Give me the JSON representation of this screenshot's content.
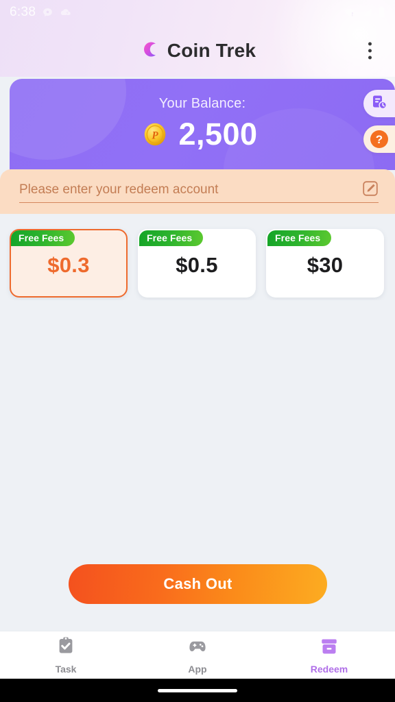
{
  "status_bar": {
    "time": "6:38",
    "left_icons": [
      "chat-bubble-icon",
      "cloud-icon"
    ],
    "right_icons": [
      "wifi-warning-icon",
      "cellular-signal-icon",
      "battery-icon"
    ]
  },
  "header": {
    "logo_icon": "coin-trek-logo-icon",
    "title": "Coin Trek",
    "menu_icon": "overflow-menu-icon"
  },
  "balance_card": {
    "label": "Your Balance:",
    "amount": "2,500",
    "coin_icon": "gold-coin-p-icon",
    "gradient_from": "#8e6ef4",
    "gradient_to": "#8d6bf3"
  },
  "side_buttons": {
    "records": {
      "icon": "records-history-icon",
      "name": "records-button"
    },
    "help": {
      "icon": "question-mark-icon",
      "label": "?",
      "name": "help-button"
    }
  },
  "account_input": {
    "placeholder": "Please enter your redeem account",
    "value": "",
    "edit_icon": "edit-pencil-icon",
    "panel_color": "#fbdcc3"
  },
  "amount_options": [
    {
      "badge": "Free Fees",
      "value": "$0.3",
      "selected": true
    },
    {
      "badge": "Free Fees",
      "value": "$0.5",
      "selected": false
    },
    {
      "badge": "Free Fees",
      "value": "$30",
      "selected": false
    }
  ],
  "cash_out": {
    "label": "Cash Out",
    "gradient_from": "#f4511e",
    "gradient_to": "#fcac21"
  },
  "bottom_nav": {
    "items": [
      {
        "label": "Task",
        "icon": "clipboard-check-icon",
        "active": false
      },
      {
        "label": "App",
        "icon": "gamepad-icon",
        "active": false
      },
      {
        "label": "Redeem",
        "icon": "redeem-card-icon",
        "active": true
      }
    ],
    "active_color": "#b06fe8",
    "inactive_color": "#8c8c91"
  }
}
